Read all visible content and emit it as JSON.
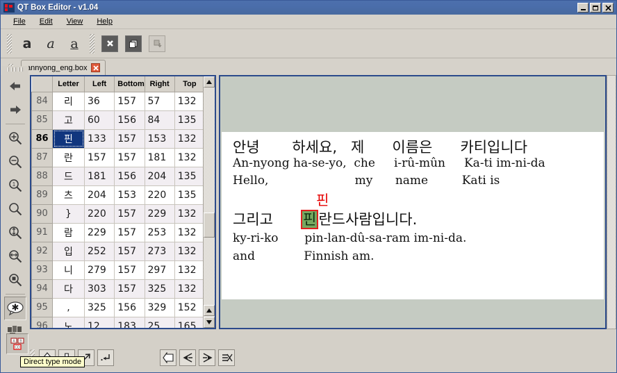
{
  "window": {
    "title": "QT Box Editor - v1.04",
    "app_icon": "app-logo-icon",
    "minimize_label": "_",
    "maximize_label": "□",
    "close_label": "✕"
  },
  "menubar": {
    "items": [
      {
        "label": "File",
        "mnemonic": "F"
      },
      {
        "label": "Edit",
        "mnemonic": "E"
      },
      {
        "label": "View",
        "mnemonic": "V"
      },
      {
        "label": "Help",
        "mnemonic": "H"
      }
    ]
  },
  "toolbar": {
    "bold_label": "a",
    "italic_label": "a",
    "underline_label": "a",
    "delete_label": "✖",
    "duplicate_label": "❐",
    "split_label": "⬓"
  },
  "tabs": [
    {
      "label": "annyong_eng.box",
      "close_label": "✕",
      "active": true
    }
  ],
  "rail": {
    "items": [
      {
        "name": "previous-icon",
        "glyph": "◀"
      },
      {
        "name": "next-icon",
        "glyph": "▶"
      },
      {
        "name": "zoom-in-icon",
        "glyph": "+"
      },
      {
        "name": "zoom-out-icon",
        "glyph": "−"
      },
      {
        "name": "zoom-original-icon",
        "glyph": "1"
      },
      {
        "name": "zoom-fit-icon",
        "glyph": ""
      },
      {
        "name": "zoom-fit-height-icon",
        "glyph": "↕"
      },
      {
        "name": "zoom-fit-width-icon",
        "glyph": "↔"
      },
      {
        "name": "zoom-selection-icon",
        "glyph": "■"
      },
      {
        "name": "show-symbol-icon",
        "glyph": "✱"
      },
      {
        "name": "show-boxes-icon",
        "glyph": "▦"
      },
      {
        "name": "direct-type-mode-icon",
        "glyph": "▣"
      }
    ]
  },
  "table": {
    "columns": [
      "",
      "Letter",
      "Left",
      "Bottom",
      "Right",
      "Top"
    ],
    "rows": [
      {
        "id": "84",
        "letter": "리",
        "left": "36",
        "bottom": "157",
        "right": "57",
        "top": "132",
        "selected": false
      },
      {
        "id": "85",
        "letter": "고",
        "left": "60",
        "bottom": "156",
        "right": "84",
        "top": "135",
        "selected": false
      },
      {
        "id": "86",
        "letter": "핀",
        "left": "133",
        "bottom": "157",
        "right": "153",
        "top": "132",
        "selected": true
      },
      {
        "id": "87",
        "letter": "란",
        "left": "157",
        "bottom": "157",
        "right": "181",
        "top": "132",
        "selected": false
      },
      {
        "id": "88",
        "letter": "드",
        "left": "181",
        "bottom": "156",
        "right": "204",
        "top": "135",
        "selected": false
      },
      {
        "id": "89",
        "letter": "츠",
        "left": "204",
        "bottom": "153",
        "right": "220",
        "top": "135",
        "selected": false
      },
      {
        "id": "90",
        "letter": "}",
        "left": "220",
        "bottom": "157",
        "right": "229",
        "top": "132",
        "selected": false
      },
      {
        "id": "91",
        "letter": "람",
        "left": "229",
        "bottom": "157",
        "right": "253",
        "top": "132",
        "selected": false
      },
      {
        "id": "92",
        "letter": "입",
        "left": "252",
        "bottom": "157",
        "right": "273",
        "top": "132",
        "selected": false
      },
      {
        "id": "93",
        "letter": "니",
        "left": "279",
        "bottom": "157",
        "right": "297",
        "top": "132",
        "selected": false
      },
      {
        "id": "94",
        "letter": "다",
        "left": "303",
        "bottom": "157",
        "right": "325",
        "top": "132",
        "selected": false
      },
      {
        "id": "95",
        "letter": ",",
        "left": "325",
        "bottom": "156",
        "right": "329",
        "top": "152",
        "selected": false
      },
      {
        "id": "96",
        "letter": "노",
        "left": "12",
        "bottom": "183",
        "right": "25",
        "top": "165",
        "selected": false
      }
    ],
    "scroll_up_label": "▲",
    "scroll_down_label": "▼"
  },
  "viewer": {
    "lines": {
      "korean_1": "안녕       하세요,   제      이름은      카티입니다",
      "roman_1": "An-nyong ha-se-yo,  che     i-rû-mûn     Ka-ti im-ni-da",
      "gloss_1": "Hello,                       my      name         Kati is",
      "ghost_char": "핀",
      "korean_2_pre": "그리고      ",
      "korean_2_sel": "핀",
      "korean_2_post": "란드사람입니다.",
      "roman_2": "ky-ri-ko       pin-lan-dû-sa-ram im-ni-da.",
      "gloss_2": "and             Finnish am."
    },
    "selection_color": "#76a860",
    "selection_border_color": "#e02020",
    "ghost_color": "#e60000"
  },
  "bottombar": {
    "buttons": [
      {
        "name": "move-up-button",
        "glyph": "⇧"
      },
      {
        "name": "move-down-button",
        "glyph": "⇩"
      },
      {
        "name": "resize-button",
        "glyph": "⬈"
      },
      {
        "name": "insert-newline-button",
        "glyph": "↵"
      },
      {
        "name": "undo-button",
        "glyph": "⇦"
      },
      {
        "name": "split-button",
        "glyph": "≺"
      },
      {
        "name": "join-button",
        "glyph": "≺"
      },
      {
        "name": "delete-button",
        "glyph": "✂"
      }
    ]
  },
  "tooltip": {
    "text": "Direct type mode"
  },
  "colors": {
    "titlebar": "#4a6daa",
    "panel_border": "#2b4a8b",
    "chrome": "#d4d0c8",
    "viewer_bg": "#c5cbc2",
    "row_selected": "#11367e",
    "row_alt": "#f2eef2"
  }
}
